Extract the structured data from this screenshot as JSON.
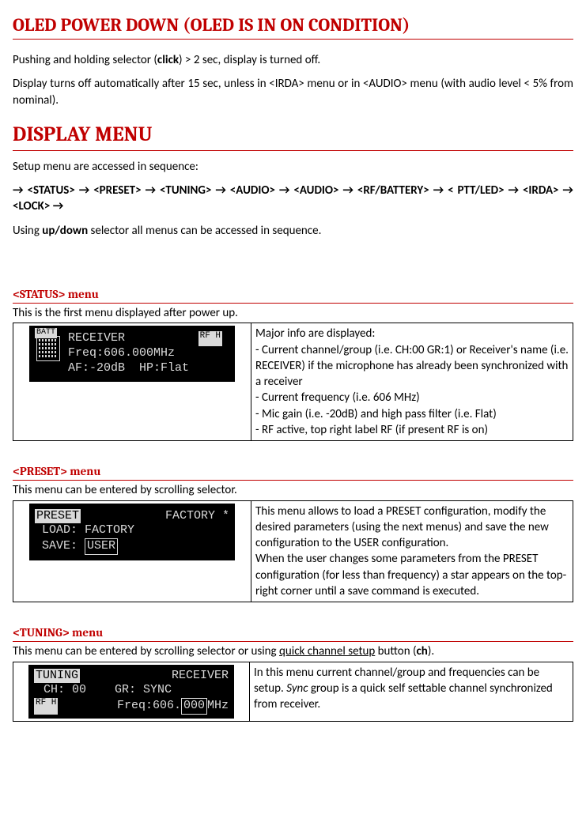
{
  "title1": "OLED POWER DOWN (OLED IS IN ON CONDITION)",
  "p1": "Pushing and holding selector (",
  "p1_bold": "click",
  "p1_end": ") > 2 sec, display is turned off.",
  "p2": "Display turns off automatically after 15 sec, unless in <IRDA> menu or in <AUDIO> menu (with audio level < 5% from nominal).",
  "title2": "DISPLAY MENU",
  "p3": "Setup menu are accessed in sequence:",
  "seq1": "→ <STATUS>  →  <PRESET>  →  <TUNING>  →  <AUDIO>  →  <AUDIO>  →  <RF/BATTERY>  → < PTT/LED>  →  <IRDA>  →  <LOCK>  →",
  "p4_pre": "Using ",
  "p4_bold": "up/down",
  "p4_end": " selector all menus can be accessed in sequence.",
  "status": {
    "heading": "<STATUS> menu",
    "intro": "This is the first menu displayed after power up.",
    "lcd": {
      "batt_label": "BATT",
      "receiver": "RECEIVER",
      "rf": "RF H",
      "line2": "Freq:606.000MHz",
      "line3": "AF:-20dB  HP:Flat"
    },
    "desc": "Major info are displayed:\n- Current channel/group (i.e. CH:00 GR:1) or Receiver's name (i.e. RECEIVER) if the microphone has already been synchronized with a receiver\n- Current frequency (i.e. 606 MHz)\n- Mic gain (i.e. -20dB) and high pass filter (i.e. Flat)\n- RF active, top right label RF (if present RF is on)"
  },
  "preset": {
    "heading": "<PRESET> menu",
    "intro": "This menu can be entered by scrolling selector.",
    "lcd": {
      "preset_label": "PRESET",
      "factory_star": "FACTORY *",
      "load": "LOAD:",
      "load_val": "FACTORY",
      "save": "SAVE:",
      "save_val": "USER"
    },
    "desc": "This menu allows to load a PRESET configuration, modify the desired parameters (using the next menus) and save the new configuration to the USER configuration.\nWhen the user changes some parameters from the PRESET configuration (for less than frequency) a star appears on the top-right corner until a save command is executed."
  },
  "tuning": {
    "heading": "<TUNING> menu",
    "intro_a": "This menu can be entered by scrolling selector or using ",
    "intro_u": "quick channel setup",
    "intro_b": " button (",
    "intro_bold": "ch",
    "intro_c": ").",
    "lcd": {
      "tuning_label": "TUNING",
      "receiver": "RECEIVER",
      "line2": "CH: 00    GR: SYNC",
      "rf": "RF H",
      "freq_a": " Freq:606.",
      "freq_b": "000",
      "freq_c": "MHz"
    },
    "desc_a": "In this menu current channel/group and frequencies can be setup. ",
    "desc_i": "Sync",
    "desc_b": " group is a quick self settable channel synchronized from receiver."
  }
}
